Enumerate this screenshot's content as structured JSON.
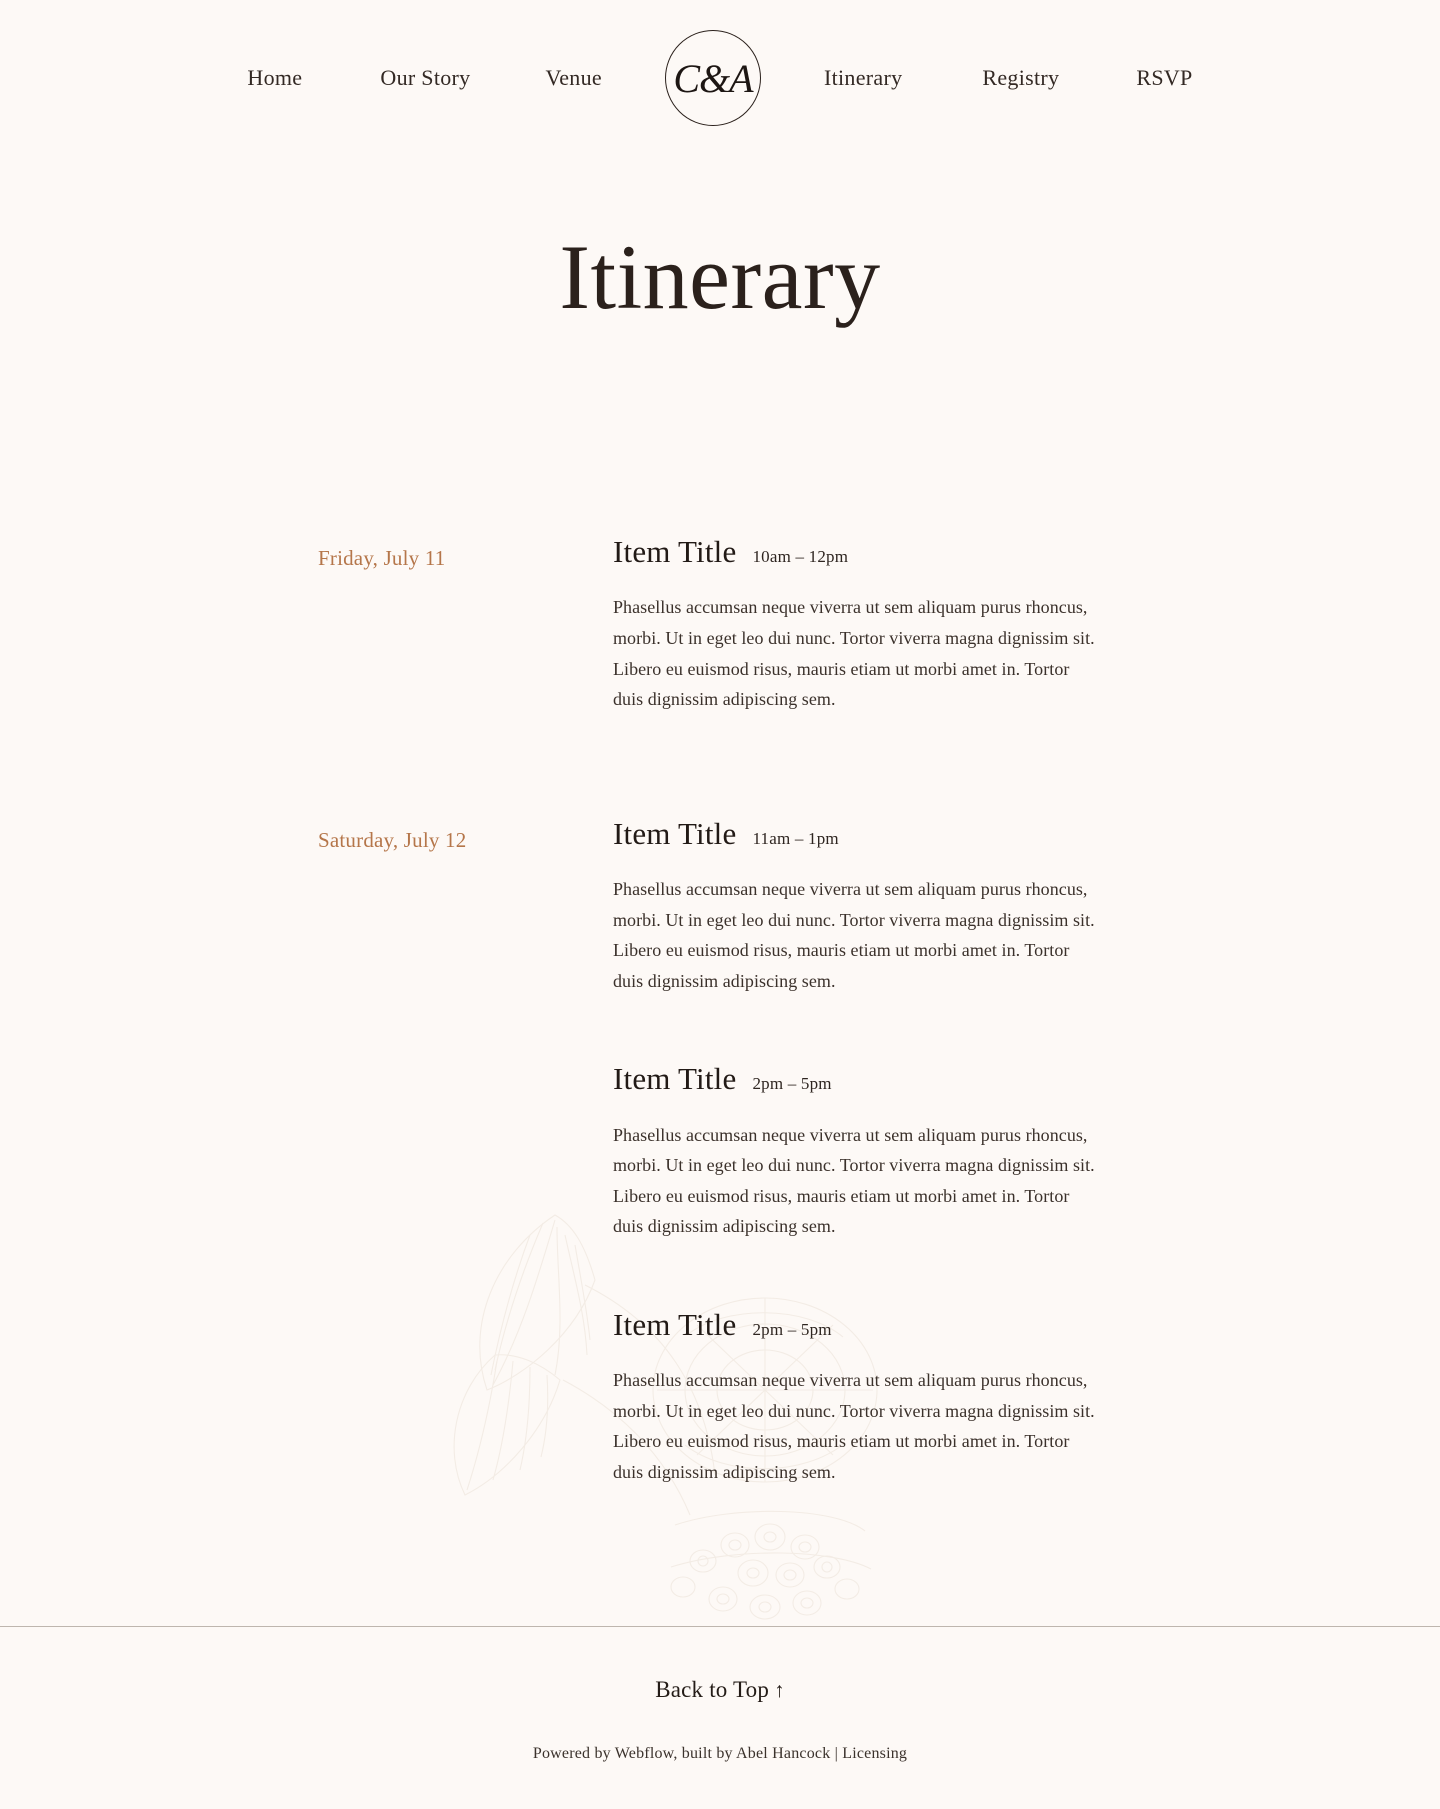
{
  "theme": {
    "background": "#fdf9f6",
    "ink": "#2b211c",
    "accent": "#b5764a",
    "rule": "#beb6ae"
  },
  "nav": {
    "left_items": [
      {
        "label": "Home",
        "name": "nav-link-home"
      },
      {
        "label": "Our Story",
        "name": "nav-link-our-story"
      },
      {
        "label": "Venue",
        "name": "nav-link-venue"
      }
    ],
    "logo": {
      "monogram": "C&A"
    },
    "right_items": [
      {
        "label": "Itinerary",
        "name": "nav-link-itinerary"
      },
      {
        "label": "Registry",
        "name": "nav-link-registry"
      },
      {
        "label": "RSVP",
        "name": "nav-link-rsvp"
      }
    ]
  },
  "header": {
    "title": "Itinerary"
  },
  "itinerary": {
    "days": [
      {
        "date_label": "Friday, July 11",
        "events": [
          {
            "title": "Item Title",
            "time": "10am – 12pm",
            "description": "Phasellus accumsan neque viverra ut sem aliquam purus rhoncus, morbi. Ut in eget leo dui nunc. Tortor viverra magna dignissim sit. Libero eu euismod risus, mauris etiam ut morbi amet in. Tortor duis dignissim adipiscing sem."
          }
        ]
      },
      {
        "date_label": "Saturday, July 12",
        "events": [
          {
            "title": "Item Title",
            "time": "11am – 1pm",
            "description": "Phasellus accumsan neque viverra ut sem aliquam purus rhoncus, morbi. Ut in eget leo dui nunc. Tortor viverra magna dignissim sit. Libero eu euismod risus, mauris etiam ut morbi amet in. Tortor duis dignissim adipiscing sem."
          },
          {
            "title": "Item Title",
            "time": "2pm – 5pm",
            "description": "Phasellus accumsan neque viverra ut sem aliquam purus rhoncus, morbi. Ut in eget leo dui nunc. Tortor viverra magna dignissim sit. Libero eu euismod risus, mauris etiam ut morbi amet in. Tortor duis dignissim adipiscing sem."
          },
          {
            "title": "Item Title",
            "time": "2pm – 5pm",
            "description": "Phasellus accumsan neque viverra ut sem aliquam purus rhoncus, morbi. Ut in eget leo dui nunc. Tortor viverra magna dignissim sit. Libero eu euismod risus, mauris etiam ut morbi amet in. Tortor duis dignissim adipiscing sem."
          }
        ]
      }
    ]
  },
  "footer": {
    "back_to_top_label": "Back to Top",
    "back_to_top_arrow": "↑",
    "colophon_prefix": "Powered by Webflow, built by Abel Hancock",
    "colophon_separator": " | ",
    "colophon_link": "Licensing"
  }
}
